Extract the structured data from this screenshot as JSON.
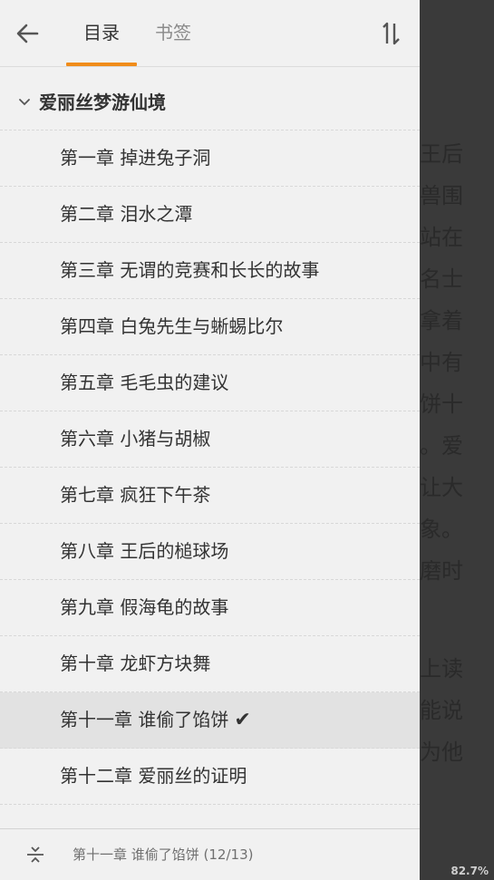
{
  "reader": {
    "lines": [
      "王后",
      "兽围",
      "站在",
      "名士",
      "拿着",
      "中有",
      "饼十",
      "。爱",
      "让大",
      "象。",
      "磨时",
      "",
      "上读",
      "能说",
      "为他"
    ],
    "progress_percent": "82.7%"
  },
  "drawer": {
    "tabs": [
      {
        "label": "目录",
        "active": true
      },
      {
        "label": "书签",
        "active": false
      }
    ],
    "icons": {
      "back": "arrow-left-icon",
      "sort": "sort-order-icon",
      "expand": "chevron-down-icon",
      "locate": "locate-current-icon",
      "check": "checkmark-icon"
    },
    "accent_color": "#f08c1a",
    "book_title": "爱丽丝梦游仙境",
    "chapters": [
      {
        "label": "第一章 掉进兔子洞"
      },
      {
        "label": "第二章 泪水之潭"
      },
      {
        "label": "第三章 无谓的竞赛和长长的故事"
      },
      {
        "label": "第四章 白兔先生与蜥蜴比尔"
      },
      {
        "label": "第五章 毛毛虫的建议"
      },
      {
        "label": "第六章 小猪与胡椒"
      },
      {
        "label": "第七章 疯狂下午茶"
      },
      {
        "label": "第八章 王后的槌球场"
      },
      {
        "label": "第九章 假海龟的故事"
      },
      {
        "label": "第十章 龙虾方块舞"
      },
      {
        "label": "第十一章 谁偷了馅饼",
        "current": true,
        "check": "✔"
      },
      {
        "label": "第十二章 爱丽丝的证明"
      }
    ],
    "current_position": "第十一章 谁偷了馅饼 (12/13)"
  }
}
